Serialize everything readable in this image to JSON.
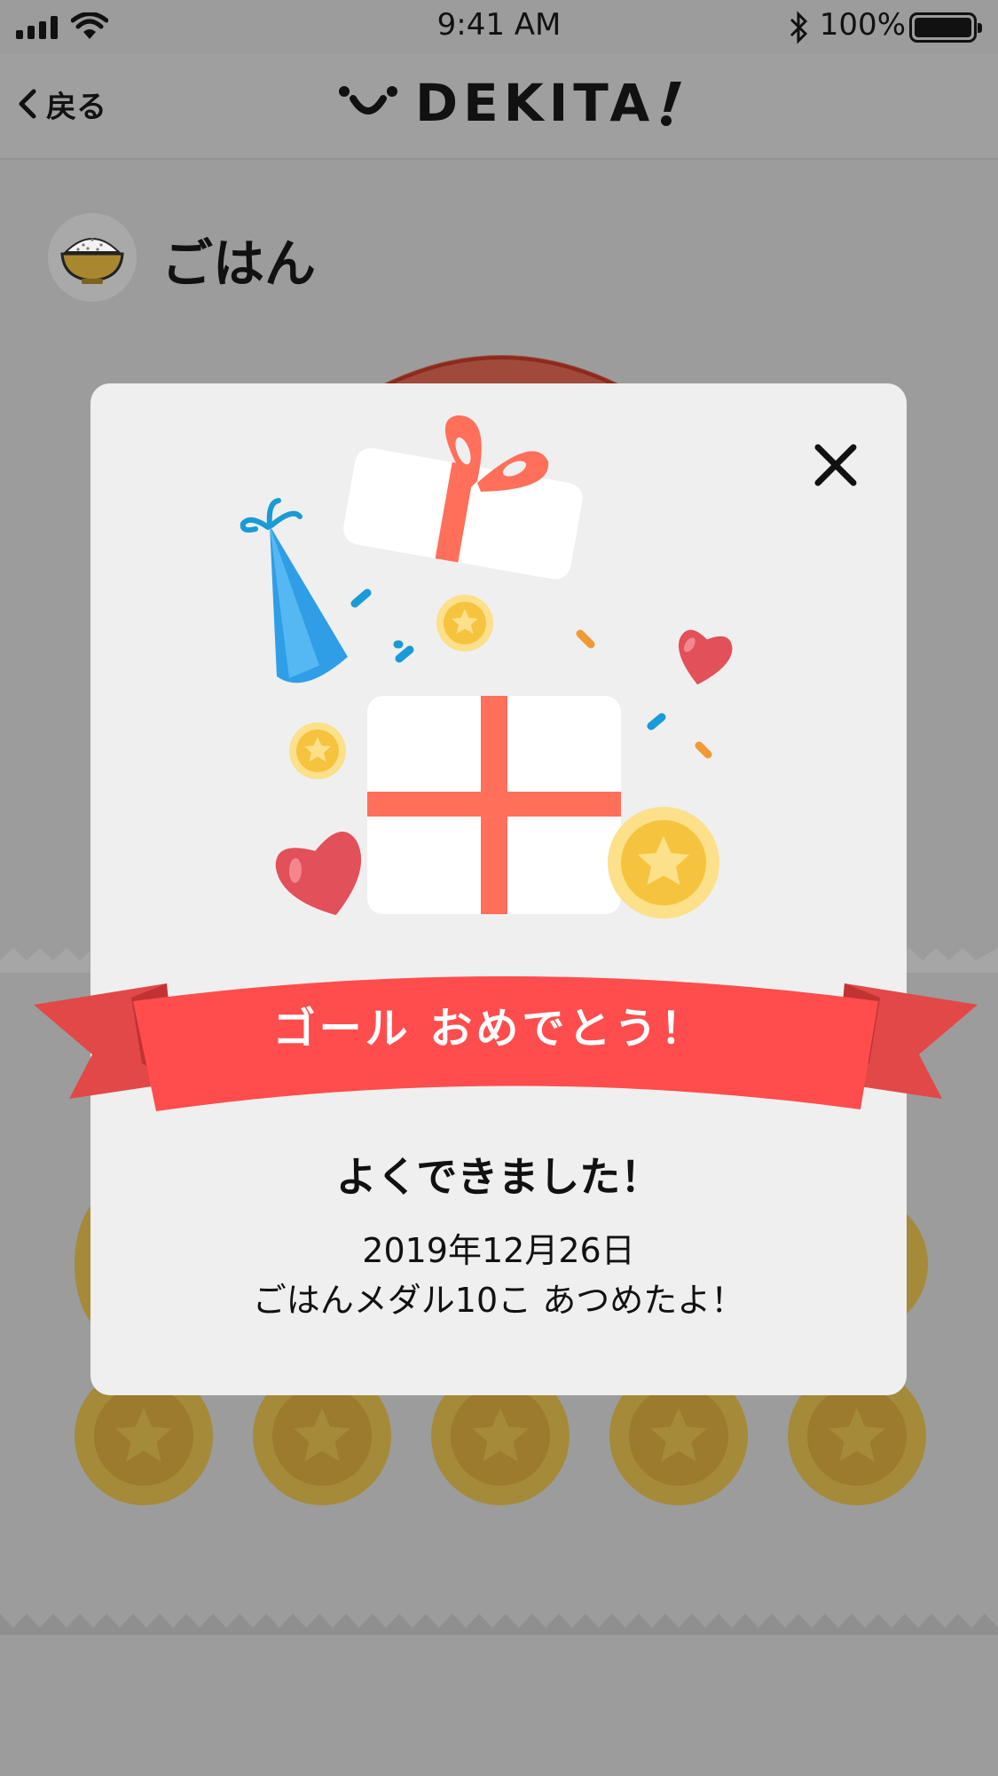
{
  "status_bar": {
    "time": "9:41 AM",
    "battery_percent": "100%",
    "signal_icon": "signal-bars-icon",
    "wifi_icon": "wifi-icon",
    "bluetooth_icon": "bluetooth-icon"
  },
  "nav": {
    "back_label": "戻る",
    "logo_text": "DEKITA"
  },
  "page": {
    "title": "ごはん",
    "avatar_icon": "rice-bowl-icon"
  },
  "modal": {
    "banner_text": "ゴール おめでとう！",
    "heading": "よくできました！",
    "date": "2019年12月26日",
    "message": "ごはんメダル10こ あつめたよ！",
    "close_icon": "close-icon"
  },
  "colors": {
    "overlay_background": "#9c9c9c",
    "modal_background": "#efefef",
    "ribbon_red": "#ff4d4d",
    "gift_ribbon": "#ff6f5a",
    "coin_gold": "#f9c843",
    "party_hat_blue": "#2f9ee6",
    "heart_red": "#e2505a"
  }
}
